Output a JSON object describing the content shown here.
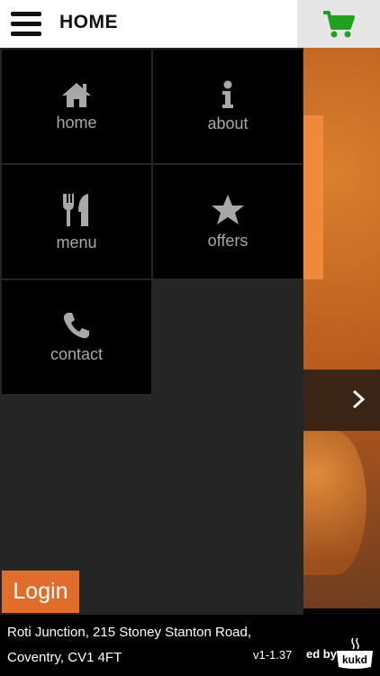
{
  "header": {
    "title": "HOME"
  },
  "menu": {
    "tiles": [
      {
        "label": "home",
        "icon": "home-icon"
      },
      {
        "label": "about",
        "icon": "info-icon"
      },
      {
        "label": "menu",
        "icon": "fork-knife-icon"
      },
      {
        "label": "offers",
        "icon": "star-icon"
      },
      {
        "label": "contact",
        "icon": "phone-icon"
      }
    ]
  },
  "login": {
    "label": "Login"
  },
  "footer": {
    "address_line1": "Roti Junction, 215 Stoney Stanton Road,",
    "address_line2": "Coventry, CV1 4FT",
    "version": "v1-1.37",
    "powered": "ed by",
    "brand": "kukd"
  },
  "colors": {
    "accent": "#e06d2c",
    "cart": "#22a022",
    "tile_text": "#a8a8a8"
  }
}
